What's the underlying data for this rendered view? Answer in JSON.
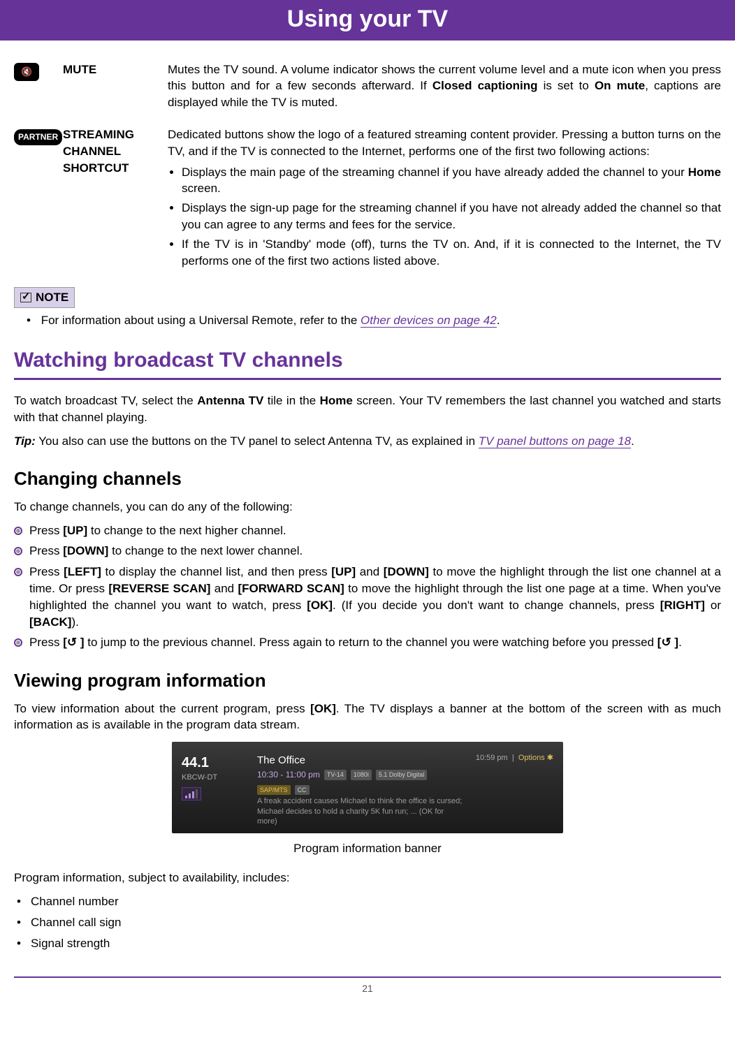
{
  "header": {
    "title": "Using your TV"
  },
  "buttons": {
    "mute": {
      "label": "MUTE",
      "desc_pre": "Mutes the TV sound. A volume indicator shows the current volume level and a mute icon when you press this button and for a few seconds afterward. If ",
      "desc_bold": "Closed captioning",
      "desc_mid": " is set to ",
      "desc_bold2": "On mute",
      "desc_post": ", captions are displayed while the TV is muted."
    },
    "partner": {
      "badge": "PARTNER",
      "label": "STREAMING CHANNEL SHORTCUT",
      "desc": "Dedicated buttons show the logo of a featured streaming content provider. Pressing a button turns on the TV, and if the TV is connected to the Internet, performs one of the first two following actions:",
      "items": [
        {
          "pre": "Displays the main page of the streaming channel if you have already added the channel to your ",
          "bold": "Home",
          "post": " screen."
        },
        {
          "pre": "Displays the sign-up page for the streaming channel if you have not already added the channel so that you can agree to any terms and fees for the service.",
          "bold": "",
          "post": ""
        },
        {
          "pre": "If the TV is in 'Standby' mode (off), turns the TV on. And, if it is connected to the Internet, the TV performs one of the first two actions listed above.",
          "bold": "",
          "post": ""
        }
      ]
    }
  },
  "note": {
    "label": "NOTE",
    "text_pre": "For information about using a Universal Remote, refer to the ",
    "link": "Other devices on page 42",
    "text_post": "."
  },
  "section": {
    "title": "Watching broadcast TV channels",
    "intro_pre": "To watch broadcast TV, select the ",
    "intro_b1": "Antenna TV",
    "intro_mid": " tile in the ",
    "intro_b2": "Home",
    "intro_post": " screen. Your TV remembers the last channel you watched and starts with that channel playing.",
    "tip_pre": "Tip:",
    "tip_body": " You also can use the buttons on the TV panel to select Antenna TV, as explained in ",
    "tip_link": "TV panel buttons on page 18",
    "tip_post": "."
  },
  "changing": {
    "title": "Changing channels",
    "intro": "To change channels, you can do any of the following:",
    "items": {
      "up": {
        "pre": "Press ",
        "b": "[UP]",
        "post": " to change to the next higher channel."
      },
      "down": {
        "pre": "Press ",
        "b": "[DOWN]",
        "post": " to change to the next lower channel."
      },
      "left": "Press [LEFT] to display the channel list, and then press [UP] and [DOWN] to move the highlight through the list one channel at a time. Or press [REVERSE SCAN] and [FORWARD SCAN] to move the highlight through the list one page at a time. When you've highlighted the channel you want to watch, press [OK]. (If you decide you don't want to change channels, press [RIGHT] or [BACK]).",
      "undo": {
        "pre": "Press ",
        "b1": "[",
        "icon": "↺",
        "b2": " ]",
        "mid": " to jump to the previous channel. Press again to return to the channel you were watching before you pressed ",
        "b3": "[",
        "b4": " ]",
        "post": "."
      }
    }
  },
  "viewing": {
    "title": "Viewing program information",
    "intro_pre": "To view information about the current program, press ",
    "intro_b": "[OK]",
    "intro_post": ". The TV displays a banner at the bottom of the screen with as much information as is available in the program data stream.",
    "caption": "Program information banner",
    "includes_label": "Program information, subject to availability, includes:",
    "includes": [
      "Channel number",
      "Channel call sign",
      "Signal strength"
    ]
  },
  "banner": {
    "channel_num": "44.1",
    "call_sign": "KBCW-DT",
    "program_title": "The Office",
    "time_range": "10:30 - 11:00 pm",
    "tags": [
      "TV-14",
      "1080i",
      "5.1 Dolby Digital"
    ],
    "tag_gold": "SAP/MTS",
    "tag_cc": "CC",
    "description": "A freak accident causes Michael to think the office is cursed; Michael decides to hold a charity 5K fun run; ... (OK for more)",
    "clock": "10:59 pm",
    "options": "Options ✱"
  },
  "page_number": "21"
}
